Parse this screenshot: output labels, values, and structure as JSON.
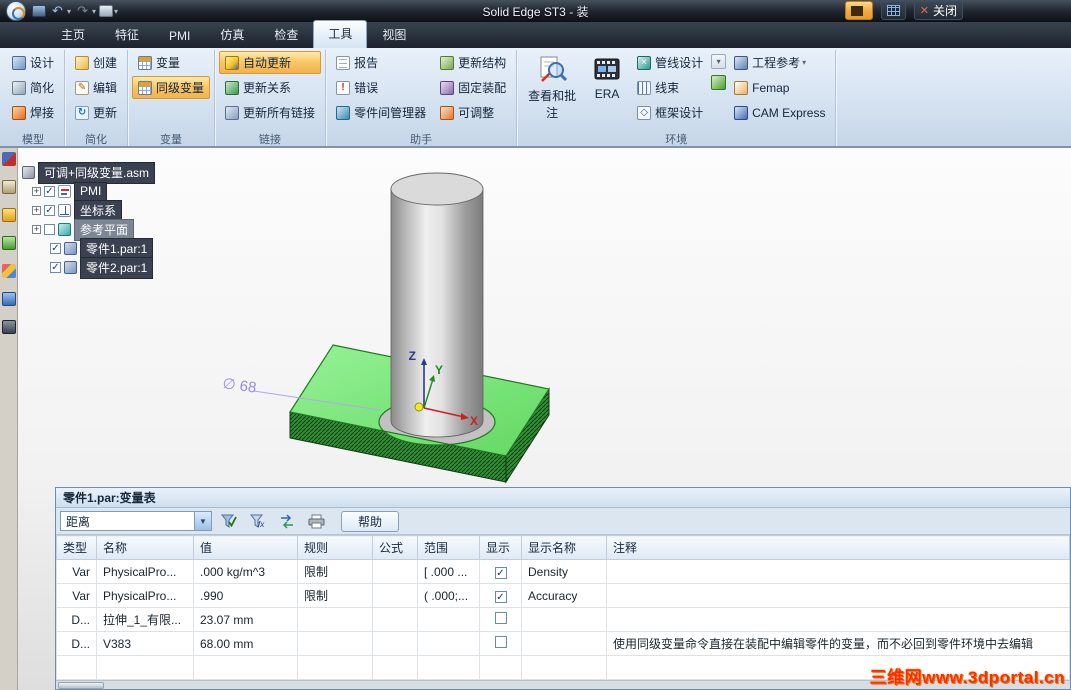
{
  "titlebar": {
    "title": "Solid Edge ST3 - 装",
    "close_label": "关闭"
  },
  "tabs": {
    "items": [
      {
        "label": "主页"
      },
      {
        "label": "特征"
      },
      {
        "label": "PMI"
      },
      {
        "label": "仿真"
      },
      {
        "label": "检查"
      },
      {
        "label": "工具",
        "active": true
      },
      {
        "label": "视图"
      }
    ]
  },
  "ribbon": {
    "groups": {
      "model": {
        "label": "模型",
        "buttons": [
          {
            "label": "设计"
          },
          {
            "label": "简化"
          },
          {
            "label": "焊接"
          }
        ]
      },
      "simplify": {
        "label": "简化",
        "buttons": [
          {
            "label": "创建"
          },
          {
            "label": "编辑"
          },
          {
            "label": "更新"
          }
        ]
      },
      "variables": {
        "label": "变量",
        "buttons": [
          {
            "label": "变量"
          },
          {
            "label": "同级变量",
            "highlighted": true
          }
        ]
      },
      "links": {
        "label": "链接",
        "buttons": [
          {
            "label": "自动更新",
            "highlighted": true
          },
          {
            "label": "更新关系"
          },
          {
            "label": "更新所有链接"
          }
        ]
      },
      "assistants": {
        "label": "助手",
        "col1": [
          {
            "label": "报告"
          },
          {
            "label": "错误"
          },
          {
            "label": "零件间管理器"
          }
        ],
        "col2": [
          {
            "label": "更新结构"
          },
          {
            "label": "固定装配"
          },
          {
            "label": "可调整"
          }
        ]
      },
      "environment": {
        "label": "环境",
        "big": [
          {
            "label": "查看和批注"
          },
          {
            "label": "ERA"
          }
        ],
        "col1": [
          {
            "label": "管线设计"
          },
          {
            "label": "线束"
          },
          {
            "label": "框架设计"
          }
        ],
        "col2": [
          {
            "label": "工程参考"
          },
          {
            "label": "Femap"
          },
          {
            "label": "CAM Express"
          }
        ]
      }
    }
  },
  "tree": {
    "items": [
      {
        "label": "可调+同级变量.asm"
      },
      {
        "label": "PMI",
        "checked": true
      },
      {
        "label": "坐标系",
        "checked": true
      },
      {
        "label": "参考平面",
        "checked": false
      },
      {
        "label": "零件1.par:1",
        "checked": true
      },
      {
        "label": "零件2.par:1",
        "checked": true
      }
    ]
  },
  "viewport": {
    "dimension": "∅ 68",
    "axes": {
      "x": "X",
      "y": "Y",
      "z": "Z"
    }
  },
  "varpanel": {
    "title": "零件1.par:变量表",
    "filter": "距离",
    "fx": "fx",
    "help": "帮助",
    "headers": [
      "类型",
      "名称",
      "值",
      "规则",
      "公式",
      "范围",
      "显示",
      "显示名称",
      "注释"
    ],
    "rows": [
      {
        "type": "Var",
        "name": "PhysicalPro...",
        "value": ".000 kg/m^3",
        "rule": "限制",
        "formula": "",
        "range": "[ .000 ...",
        "show": true,
        "display_name": "Density",
        "comment": ""
      },
      {
        "type": "Var",
        "name": "PhysicalPro...",
        "value": ".990",
        "rule": "限制",
        "formula": "",
        "range": "( .000;...",
        "show": true,
        "display_name": "Accuracy",
        "comment": ""
      },
      {
        "type": "D...",
        "name": "拉伸_1_有限...",
        "value": "23.07 mm",
        "rule": "",
        "formula": "",
        "range": "",
        "show": false,
        "display_name": "",
        "comment": ""
      },
      {
        "type": "D...",
        "name": "V383",
        "value": "68.00 mm",
        "rule": "",
        "formula": "",
        "range": "",
        "show": false,
        "display_name": "",
        "comment": "使用同级变量命令直接在装配中编辑零件的变量，而不必回到零件环境中去编辑"
      }
    ]
  },
  "watermark": "三维网www.3dportal.cn",
  "colors": {
    "highlight_orange": "#f6bd4e",
    "plate_green": "#7ce87c",
    "dimension_purple": "#9a86e8",
    "watermark_red": "#ff2d00",
    "titlebar_dark": "#1b222c"
  }
}
